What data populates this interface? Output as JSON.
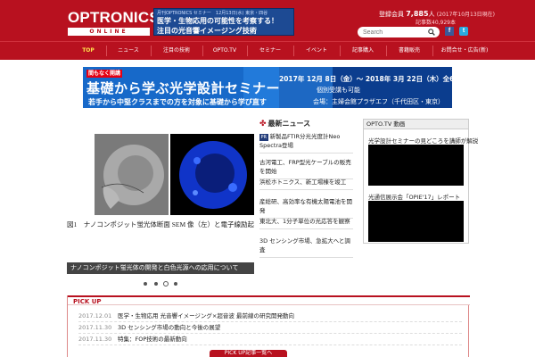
{
  "header": {
    "logo_main": "OPTRONICS",
    "logo_sub": "ONLINE",
    "banner_small": "月刊OPTRONICS セミナー　12月13日(水) 東京・四谷",
    "banner_line1": "医学・生物応用の可能性を考察する！",
    "banner_line2": "注目の光音響イメージング技術",
    "stat_label": "登録会員",
    "stat_value": "7,885",
    "stat_unit": "人",
    "stat_date": "(2017年10月13日現在)",
    "stat_sub": "記事数40,929本",
    "search_placeholder": "Search",
    "facebook_glyph": "f",
    "twitter_glyph": "t"
  },
  "nav": [
    "TOP",
    "ニュース",
    "注目の技術",
    "OPTO.TV",
    "セミナー",
    "イベント",
    "記事購入",
    "書籍販売",
    "お問合せ・広告(新)"
  ],
  "banner": {
    "tag": "間もなく開講",
    "title": "基礎から学ぶ光学設計セミナー",
    "subtitle": "若手から中堅クラスまでの方を対象に基礎から学び直す",
    "date": "2017年 12月 8日（金）～ 2018年 3月 22日（木）全6回",
    "note1": "個別受講も可能",
    "note2": "会場：主婦会館プラザエフ（千代田区・東京）"
  },
  "slider": {
    "caption": "図1　ナノコンポジット蛍光体断面 SEM 像（左）と電子線励起光像（右）",
    "title": "ナノコンポジット蛍光体の開発と白色光源への応用について"
  },
  "news": {
    "heading": "最新ニュース",
    "items": [
      {
        "tag": "PR",
        "text": "新製品FTIR分光光度計Neo Spectra登場"
      },
      {
        "tag": "",
        "text": "古河電工、FRP型光ケーブルの販売を開始"
      },
      {
        "tag": "",
        "text": "浜松ホトニクス、新工場棟を竣工"
      },
      {
        "tag": "",
        "text": "産総研、高効率な有機太陽電池を開発"
      },
      {
        "tag": "",
        "text": "東北大、1分子単位の光応答を観察"
      },
      {
        "tag": "",
        "text": "3D センシング市場、急拡大へと調査"
      }
    ]
  },
  "opto_tv": {
    "heading": "OPTO.TV 動画",
    "video1_title": "光学設計セミナーの見どころを講師が解説",
    "video2_title": "光通信展示会「OPIE'17」レポート"
  },
  "pickup": {
    "label": "PICK UP",
    "items": [
      {
        "date": "2017.12.01",
        "text": "医学・生物応用 光音響イメージング×超音波 最前線の研究開発動向"
      },
      {
        "date": "2017.11.30",
        "text": "3D センシング市場の動向と今後の展望"
      },
      {
        "date": "2017.11.30",
        "text": "特集：FOP技術の最新動向"
      }
    ],
    "button": "PICK UP記事一覧へ"
  }
}
